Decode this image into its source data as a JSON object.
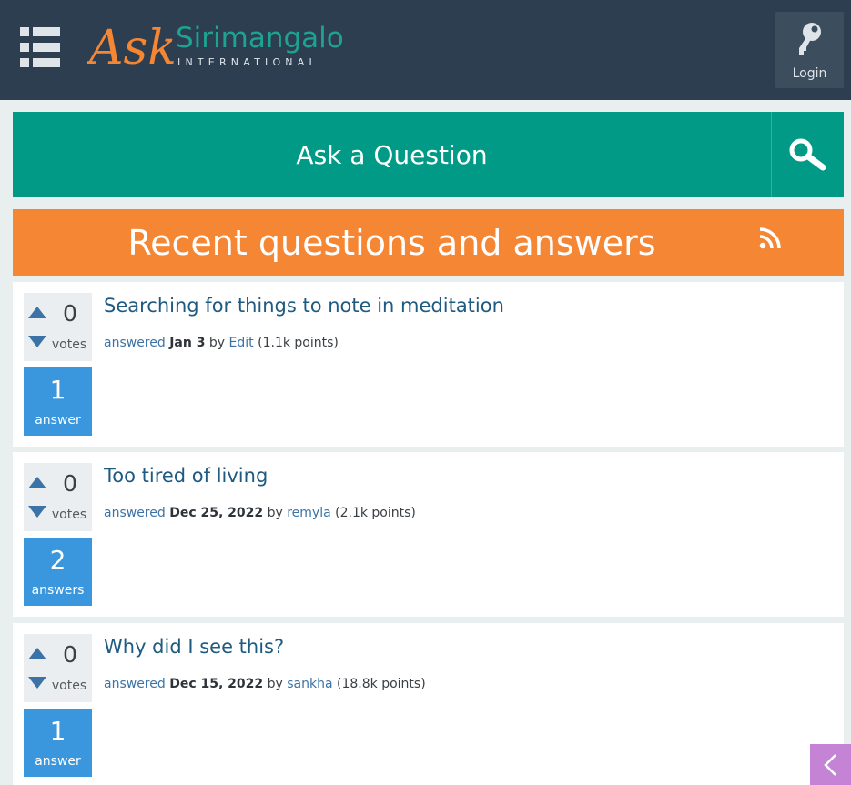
{
  "header": {
    "logo_word_1": "Ask",
    "logo_word_2": "Sirimangalo",
    "logo_word_3": "INTERNATIONAL",
    "login_label": "Login"
  },
  "ask": {
    "label": "Ask a Question"
  },
  "recent": {
    "title": "Recent questions and answers"
  },
  "questions": [
    {
      "votes": "0",
      "votes_label": "votes",
      "answers": "1",
      "answers_label": "answer",
      "title": "Searching for things to note in meditation",
      "action": "answered",
      "when": "Jan 3",
      "by": "by",
      "user": "Edit",
      "points": "(1.1k points)"
    },
    {
      "votes": "0",
      "votes_label": "votes",
      "answers": "2",
      "answers_label": "answers",
      "title": "Too tired of living",
      "action": "answered",
      "when": "Dec 25, 2022",
      "by": "by",
      "user": "remyla",
      "points": "(2.1k points)"
    },
    {
      "votes": "0",
      "votes_label": "votes",
      "answers": "1",
      "answers_label": "answer",
      "title": "Why did I see this?",
      "action": "answered",
      "when": "Dec 15, 2022",
      "by": "by",
      "user": "sankha",
      "points": "(18.8k points)"
    }
  ],
  "colors": {
    "header_bg": "#2c3e50",
    "ask_bar": "#009a86",
    "recent_bar": "#f58634",
    "answer_box": "#3a96dd",
    "logo_orange": "#f58634",
    "logo_teal": "#1ea391",
    "side_tab": "#c583d6"
  },
  "icons": {
    "menu": "hamburger-icon",
    "login": "key-icon",
    "search": "search-icon",
    "rss": "rss-icon",
    "vote_up": "triangle-up-icon",
    "vote_down": "triangle-down-icon",
    "collapse": "chevron-left-icon"
  }
}
